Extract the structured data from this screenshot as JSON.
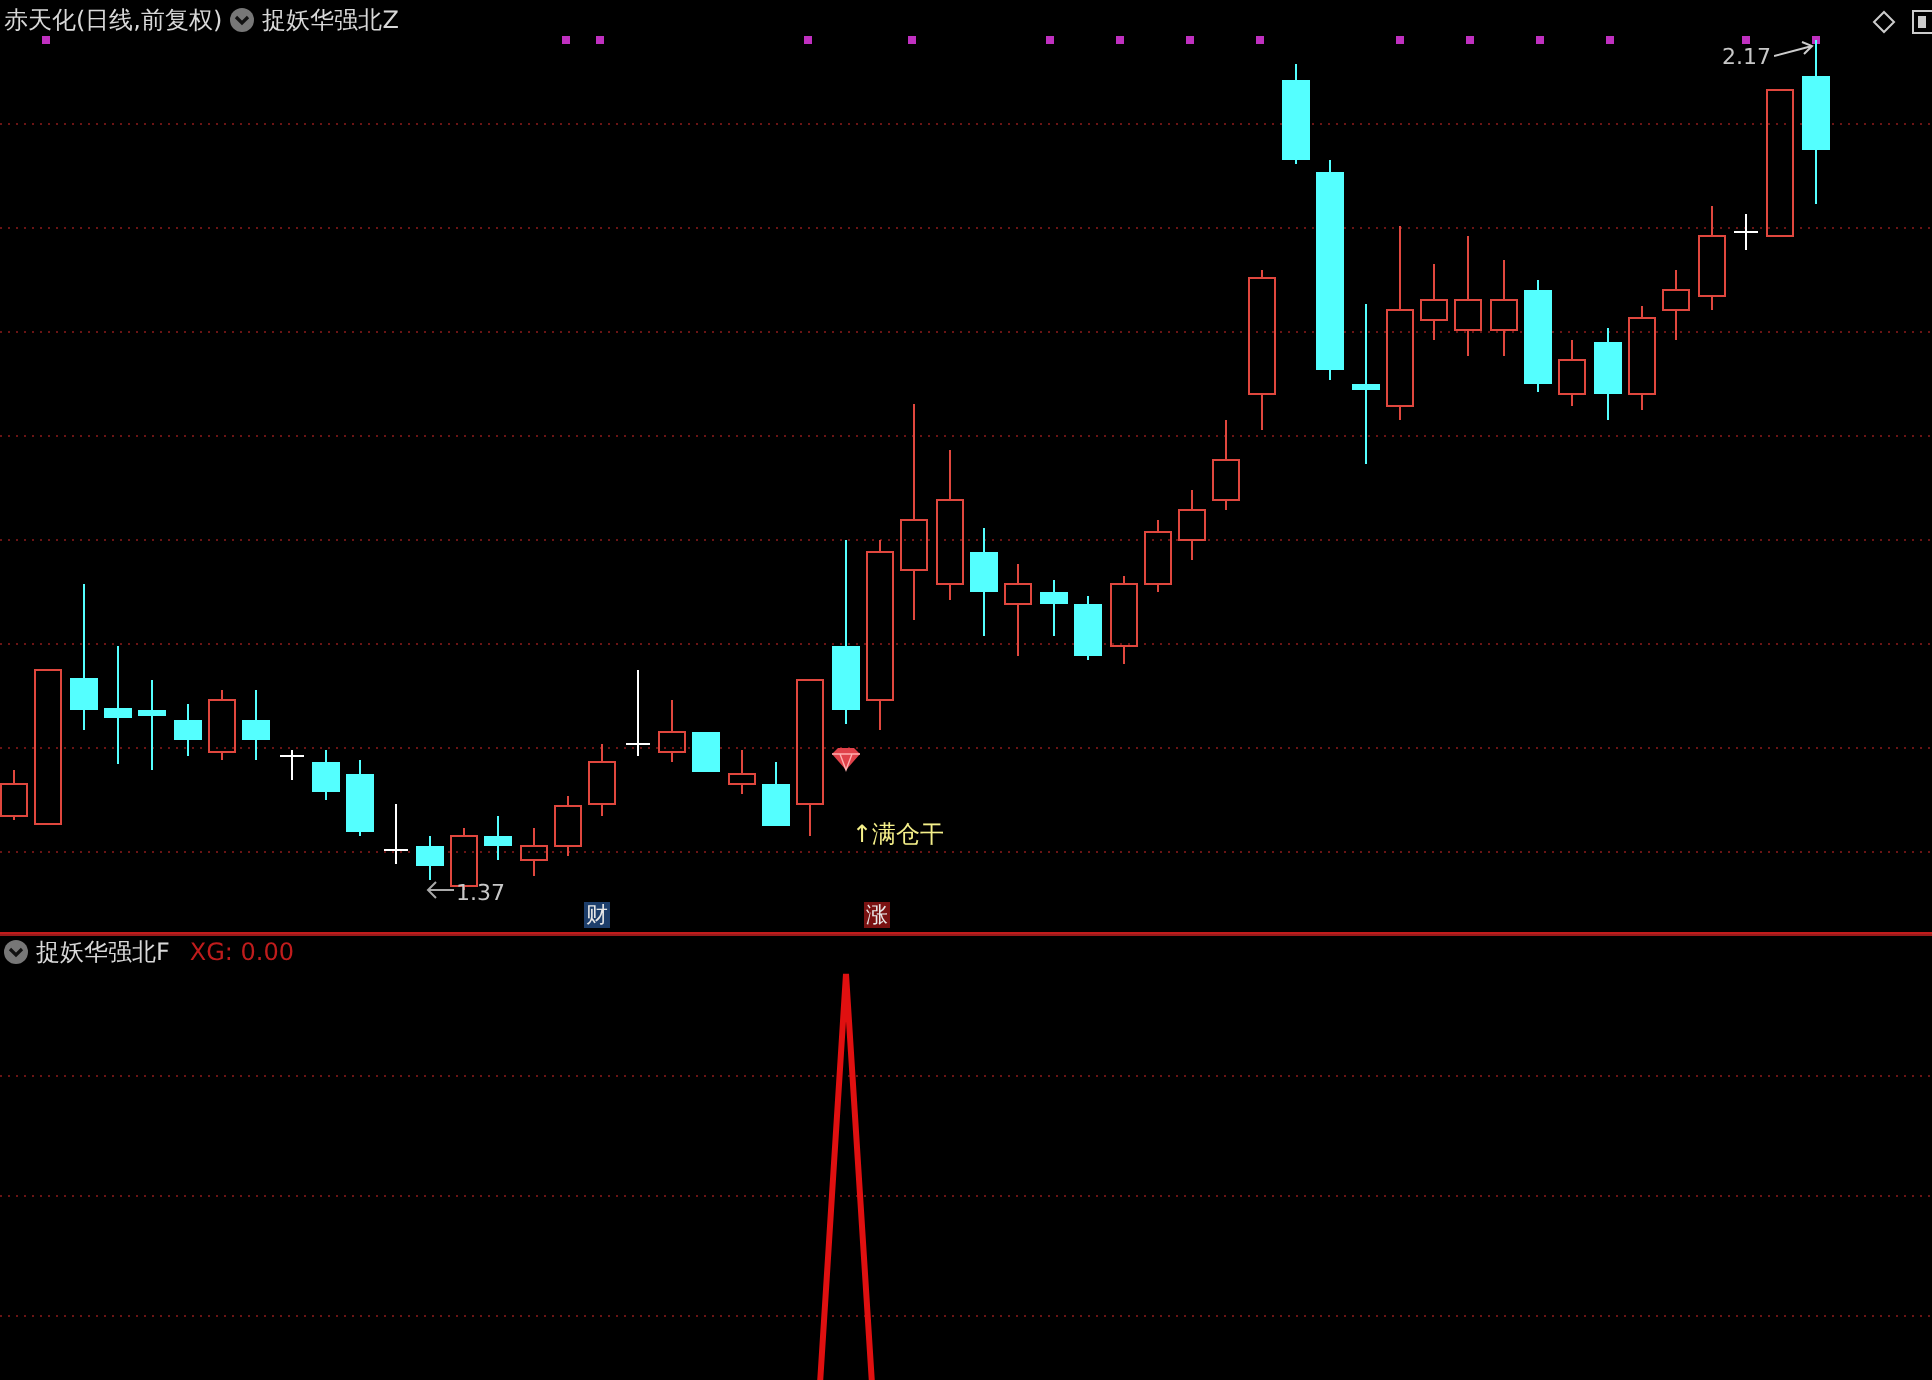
{
  "main_panel": {
    "title": "赤天化(日线,前复权)",
    "indicator_name": "捉妖华强北Z",
    "high_label": "2.17",
    "low_label": "1.37",
    "signal_text": "↑满仓干",
    "markers": [
      {
        "text": "财",
        "color": "#1d3e6b"
      },
      {
        "text": "涨",
        "color": "#7a1212"
      }
    ]
  },
  "sub_panel": {
    "indicator_name": "捉妖华强北F",
    "reading": "XG: 0.00"
  }
}
